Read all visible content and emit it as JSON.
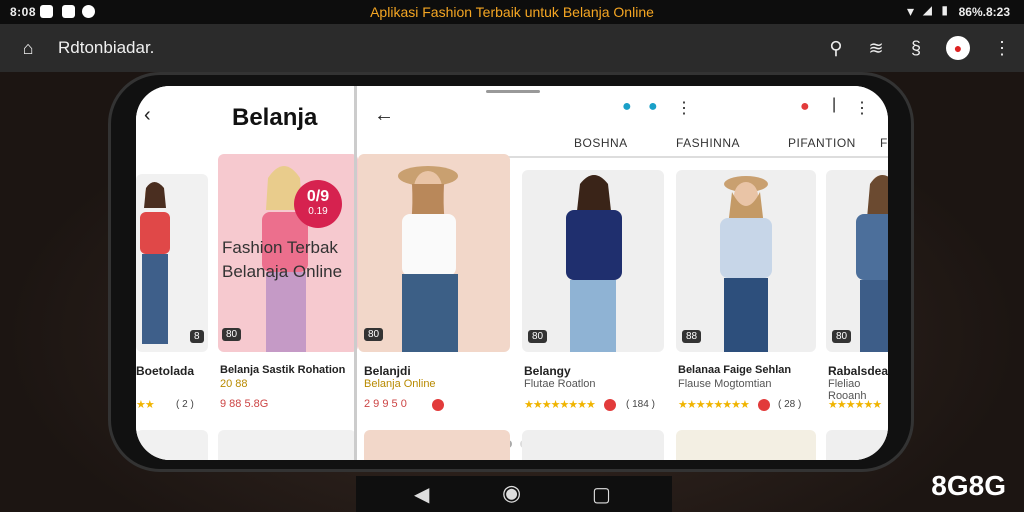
{
  "status_bar": {
    "time": "8:08",
    "title": "Aplikasi Fashion Terbaik untuk Belanja Online",
    "right_text": "86%.8:23"
  },
  "app_bar": {
    "title": "Rdtonbiadar."
  },
  "phone": {
    "left_panel": {
      "title": "Belanja",
      "banner_line1": "Fashion Terbak",
      "banner_line2": "Belanaja Online",
      "banner_badge": "0/9",
      "banner_badge_sub": "0.19",
      "items": [
        {
          "badge": "8",
          "name": "Boetolada",
          "sub": "",
          "rating": "( 2 )"
        },
        {
          "badge": "80",
          "name": "Belanja Sastik Rohation",
          "price": "20 88",
          "price2": "9 88 5.8G"
        }
      ]
    },
    "right_panel": {
      "tabs": [
        "BOSHNA",
        "FASHINNA",
        "PIFANTION",
        "F"
      ],
      "items": [
        {
          "badge": "80",
          "name": "Belanjdi",
          "sub": "Belanja Online",
          "price": "2 9 9 5 0",
          "rating": ""
        },
        {
          "badge": "80",
          "name": "Belangy",
          "sub": "Flutae Roatlon",
          "rating": "( 184 )"
        },
        {
          "badge": "88",
          "name": "Belanaa Faige Sehlan",
          "sub": "Flause Mogtomtian",
          "rating": "( 28 )"
        },
        {
          "badge": "80",
          "name": "Rabalsdea",
          "sub": "Fleliao Rooanh",
          "rating": ""
        }
      ]
    }
  },
  "watermark": "8G8G",
  "colors": {
    "accent_orange": "#f5a623",
    "red": "#e23b3b",
    "pink_banner": "#f6c9cf",
    "star": "#f0b400"
  }
}
